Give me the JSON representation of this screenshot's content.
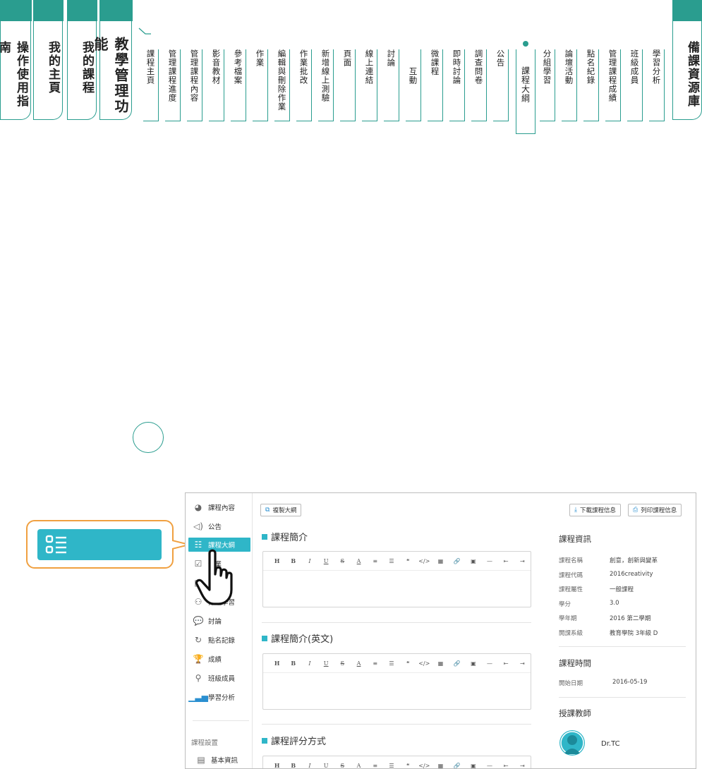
{
  "nav": {
    "left_tabs": [
      "操作使用指南",
      "我的主頁",
      "我的課程"
    ],
    "section_tab": "教學管理功能",
    "sub_tabs": [
      "課程主頁",
      "管理課程進度",
      "管理課程內容",
      "影音教材",
      "參考檔案",
      "作業",
      "編輯與刪除作業",
      "作業批改",
      "新增線上測驗",
      "頁面",
      "線上連結",
      "討論",
      "互動",
      "微課程",
      "即時討論",
      "調查問卷",
      "公告",
      "課程大綱",
      "分組學習",
      "論壇活動",
      "點名紀錄",
      "管理課程成績",
      "班級成員",
      "學習分析"
    ],
    "active_sub_tab": "課程大綱",
    "right_tab": "備課資源庫"
  },
  "sidebar": {
    "items": [
      {
        "label": "課程內容",
        "icon": "course-content-icon"
      },
      {
        "label": "公告",
        "icon": "megaphone-icon"
      },
      {
        "label": "課程大綱",
        "icon": "outline-list-icon"
      },
      {
        "label": "作業",
        "icon": "assignment-icon"
      },
      {
        "label": "測驗",
        "icon": "quiz-icon"
      },
      {
        "label": "分組學習",
        "icon": "group-icon"
      },
      {
        "label": "討論",
        "icon": "chat-icon"
      },
      {
        "label": "點名記錄",
        "icon": "rollcall-icon"
      },
      {
        "label": "成績",
        "icon": "trophy-icon"
      },
      {
        "label": "班級成員",
        "icon": "members-icon"
      },
      {
        "label": "學習分析",
        "icon": "analytics-icon"
      }
    ],
    "section_label": "課程設置",
    "settings_item": "基本資訊"
  },
  "toolbar": {
    "copy_outline": "複製大綱",
    "download_info": "下載課程信息",
    "print_info": "列印課程信息"
  },
  "sections": [
    "課程簡介",
    "課程簡介(英文)",
    "課程評分方式"
  ],
  "editor_buttons": [
    "H",
    "B",
    "I",
    "U",
    "S",
    "A",
    "≡",
    "☰",
    "❝",
    "</>",
    "▦",
    "🔗",
    "▣",
    "—",
    "⇤",
    "⇥"
  ],
  "course_info": {
    "title": "課程資訊",
    "rows": [
      {
        "key": "課程名稱",
        "value": "創意，創新與變革"
      },
      {
        "key": "課程代碼",
        "value": "2016creativity"
      },
      {
        "key": "課程屬性",
        "value": "一般課程"
      },
      {
        "key": "學分",
        "value": "3.0"
      },
      {
        "key": "學年期",
        "value": "2016 第二學期"
      },
      {
        "key": "開課系級",
        "value": "教育學院 3年級 D"
      }
    ]
  },
  "course_time": {
    "title": "課程時間",
    "start_label": "開始日期",
    "start_value": "2016-05-19"
  },
  "teacher": {
    "title": "授課教師",
    "name": "Dr.TC"
  },
  "colors": {
    "accent": "#2a9d8f",
    "active_cyan": "#2fb6c8",
    "callout_border": "#f0a040"
  }
}
